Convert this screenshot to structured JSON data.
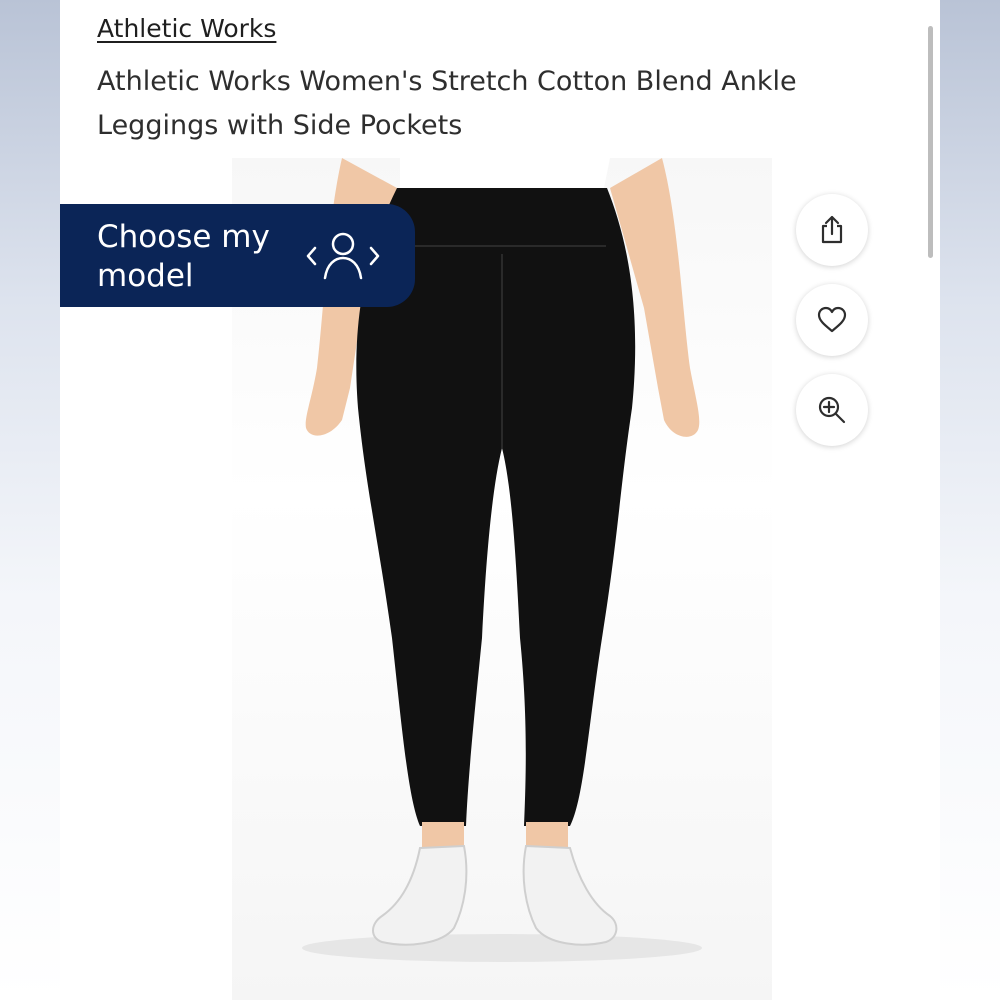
{
  "product": {
    "brand": "Athletic Works",
    "title": "Athletic Works Women's Stretch Cotton Blend Ankle Leggings with Side Pockets"
  },
  "model_selector": {
    "label": "Choose my model",
    "icon": "person-switch-icon"
  },
  "actions": [
    {
      "icon": "share-icon"
    },
    {
      "icon": "heart-icon"
    },
    {
      "icon": "zoom-in-icon"
    }
  ],
  "colors": {
    "accent": "#0b2557",
    "leggings": "#111111"
  }
}
